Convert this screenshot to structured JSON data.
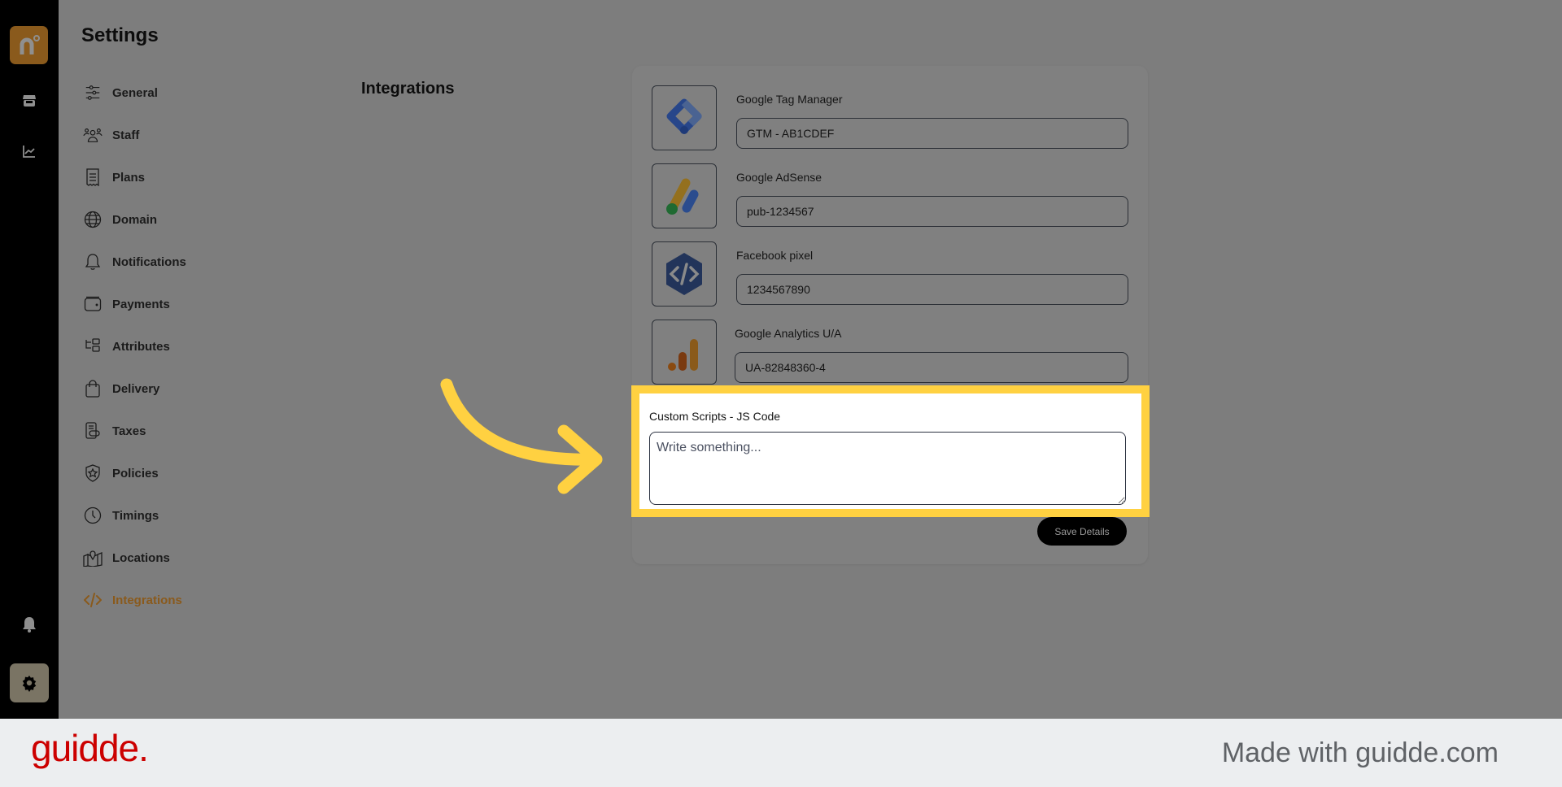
{
  "rail": {
    "logo_letter": "n",
    "icons": [
      "store-icon",
      "chart-line-icon",
      "bell-icon",
      "gear-icon"
    ]
  },
  "settings": {
    "title": "Settings",
    "nav": [
      {
        "label": "General",
        "icon": "sliders-icon",
        "active": false
      },
      {
        "label": "Staff",
        "icon": "users-icon",
        "active": false
      },
      {
        "label": "Plans",
        "icon": "receipt-icon",
        "active": false
      },
      {
        "label": "Domain",
        "icon": "globe-icon",
        "active": false
      },
      {
        "label": "Notifications",
        "icon": "bell-icon",
        "active": false
      },
      {
        "label": "Payments",
        "icon": "wallet-icon",
        "active": false
      },
      {
        "label": "Attributes",
        "icon": "folder-tree-icon",
        "active": false
      },
      {
        "label": "Delivery",
        "icon": "bag-icon",
        "active": false
      },
      {
        "label": "Taxes",
        "icon": "tax-receipt-icon",
        "active": false
      },
      {
        "label": "Policies",
        "icon": "shield-star-icon",
        "active": false
      },
      {
        "label": "Timings",
        "icon": "clock-icon",
        "active": false
      },
      {
        "label": "Locations",
        "icon": "map-pin-icon",
        "active": false
      },
      {
        "label": "Integrations",
        "icon": "code-icon",
        "active": true
      }
    ]
  },
  "main": {
    "section_title": "Integrations",
    "integrations": [
      {
        "name": "Google Tag Manager",
        "value": "GTM - AB1CDEF",
        "logo": "google-tag-manager-logo"
      },
      {
        "name": "Google AdSense",
        "value": "pub-1234567",
        "logo": "google-adsense-logo"
      },
      {
        "name": "Facebook pixel",
        "value": "1234567890",
        "logo": "facebook-pixel-logo"
      },
      {
        "name": "Google Analytics U/A",
        "value": "UA-82848360-4",
        "logo": "google-analytics-logo"
      }
    ],
    "custom_scripts": {
      "label": "Custom Scripts - JS Code",
      "placeholder": "Write something...",
      "value": ""
    },
    "save_label": "Save Details"
  },
  "colors": {
    "accent": "#8a5a1c",
    "highlight": "#ffd141",
    "brand_red": "#cc0000"
  },
  "footer": {
    "brand": "guidde.",
    "made_with": "Made with guidde.com"
  }
}
